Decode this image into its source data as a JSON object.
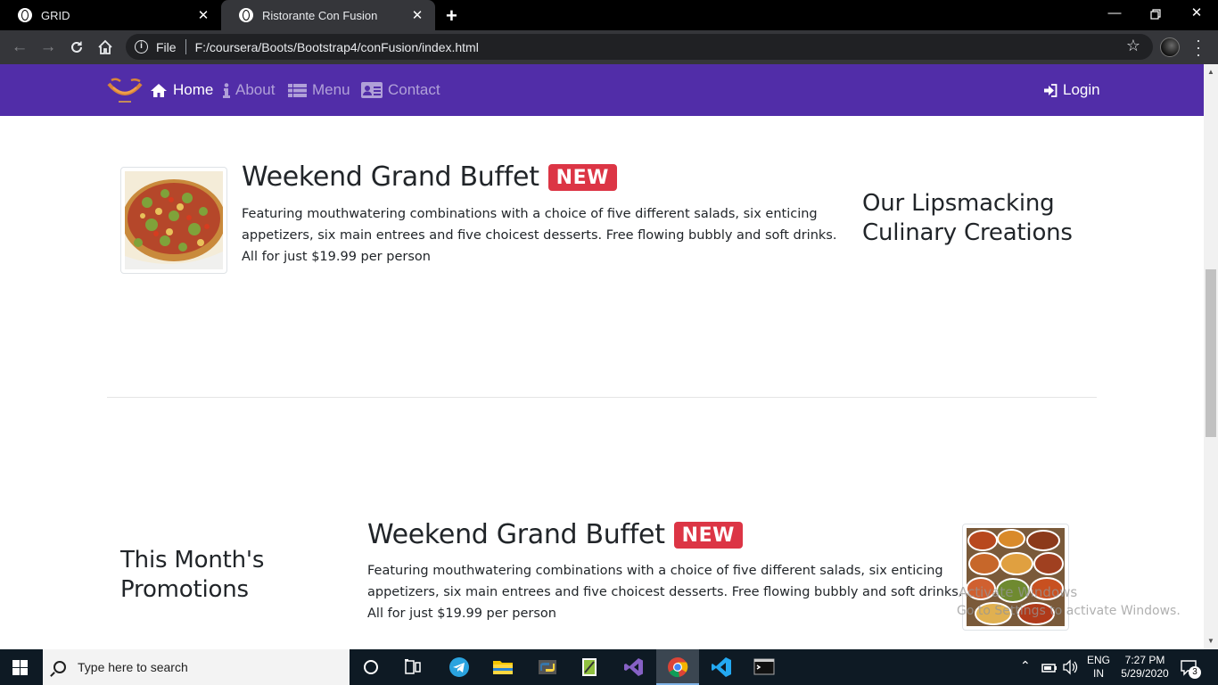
{
  "browser": {
    "tabs": [
      {
        "title": "GRID",
        "active": false
      },
      {
        "title": "Ristorante Con Fusion",
        "active": true
      }
    ],
    "new_tab_icon": "plus-icon",
    "window_controls": [
      "minimize-icon",
      "restore-icon",
      "close-icon"
    ],
    "address": {
      "scheme_label": "File",
      "url": "F:/coursera/Boots/Bootstrap4/conFusion/index.html"
    }
  },
  "navbar": {
    "background_color": "#512da8",
    "items": [
      {
        "label": "Home",
        "icon": "home-icon",
        "active": true
      },
      {
        "label": "About",
        "icon": "info-icon",
        "active": false
      },
      {
        "label": "Menu",
        "icon": "list-icon",
        "active": false
      },
      {
        "label": "Contact",
        "icon": "address-card-icon",
        "active": false
      }
    ],
    "login": {
      "label": "Login",
      "icon": "sign-in-icon"
    }
  },
  "featured_dish": {
    "title": "Weekend Grand Buffet",
    "badge": "NEW",
    "description": "Featuring mouthwatering combinations with a choice of five different salads, six enticing appetizers, six main entrees and five choicest desserts. Free flowing bubbly and soft drinks. All for just $19.99 per person",
    "side_heading_line1": "Our Lipsmacking",
    "side_heading_line2": "Culinary Creations"
  },
  "promotion": {
    "side_heading_line1": "This Month's",
    "side_heading_line2": "Promotions",
    "title": "Weekend Grand Buffet",
    "badge": "NEW",
    "description": "Featuring mouthwatering combinations with a choice of five different salads, six enticing appetizers, six main entrees and five choicest desserts. Free flowing bubbly and soft drinks. All for just $19.99 per person"
  },
  "watermark": {
    "line1": "Activate Windows",
    "line2": "Go to Settings to activate Windows."
  },
  "taskbar": {
    "search_placeholder": "Type here to search",
    "language_line1": "ENG",
    "language_line2": "IN",
    "time": "7:27 PM",
    "date": "5/29/2020",
    "notification_count": "3"
  },
  "colors": {
    "badge": "#dc3545",
    "text": "#212529"
  }
}
